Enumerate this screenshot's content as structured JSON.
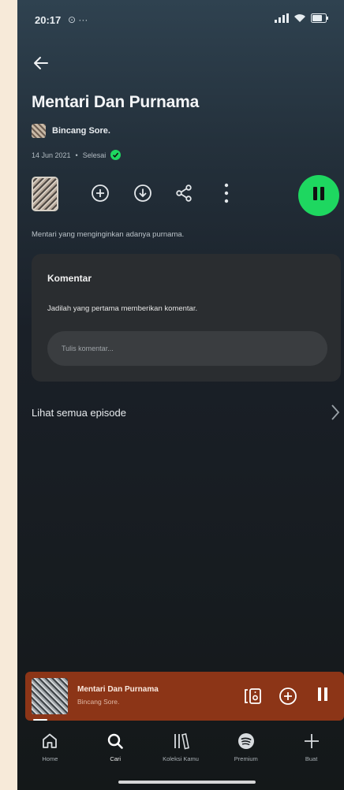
{
  "status_bar": {
    "time": "20:17",
    "extra": "⊙ ···",
    "battery": "68"
  },
  "episode": {
    "title": "Mentari Dan Purnama",
    "author": "Bincang Sore.",
    "date": "14 Jun 2021",
    "status": "Selesai",
    "description": "Mentari yang menginginkan adanya purnama."
  },
  "comments": {
    "title": "Komentar",
    "subtitle": "Jadilah yang pertama memberikan komentar.",
    "input_placeholder": "Tulis komentar..."
  },
  "see_all_label": "Lihat semua episode",
  "mini_player": {
    "title": "Mentari Dan Purnama",
    "author": "Bincang Sore."
  },
  "nav": [
    {
      "label": "Home",
      "icon": "home-icon"
    },
    {
      "label": "Cari",
      "icon": "search-icon"
    },
    {
      "label": "Koleksi Kamu",
      "icon": "library-icon"
    },
    {
      "label": "Premium",
      "icon": "spotify-icon"
    },
    {
      "label": "Buat",
      "icon": "plus-icon"
    }
  ],
  "colors": {
    "accent": "#1ed760",
    "mini_player_bg": "#8c3517"
  }
}
